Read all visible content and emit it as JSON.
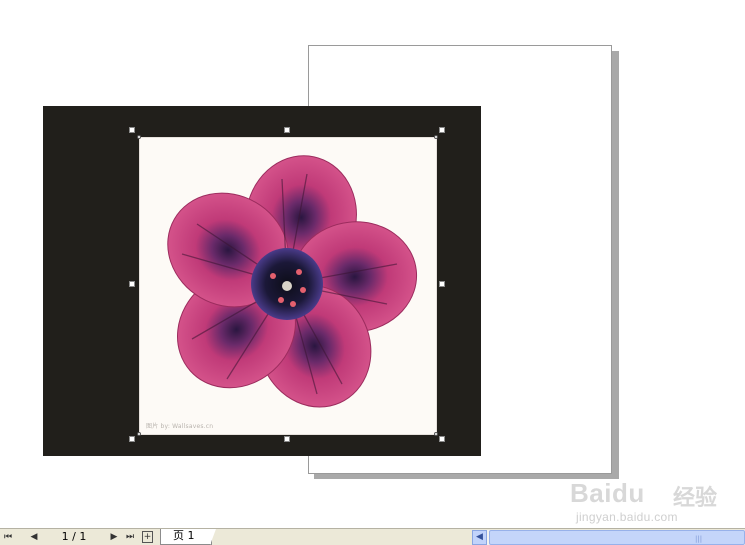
{
  "document": {
    "photo_caption": "图片 by: Wallsaves.cn"
  },
  "navbar": {
    "first_page_label": "⏮",
    "prev_page_label": "◀",
    "page_counter": "1 / 1",
    "next_page_label": "▶",
    "last_page_label": "⏭",
    "add_page_label": "+",
    "page_tab_label": "页 1"
  },
  "watermark": {
    "logo": "Baidu",
    "logo_cn": "经验",
    "url": "jingyan.baidu.com"
  },
  "icons": {
    "first": "first-page-icon",
    "prev": "prev-page-icon",
    "next": "next-page-icon",
    "last": "last-page-icon",
    "add": "add-page-icon",
    "scroll_left": "scroll-left-icon"
  },
  "colors": {
    "dark_rect": "#211f1b",
    "petal": "#c93e78",
    "navbar": "#ece9d8",
    "scroll": "#c4d5fa"
  }
}
